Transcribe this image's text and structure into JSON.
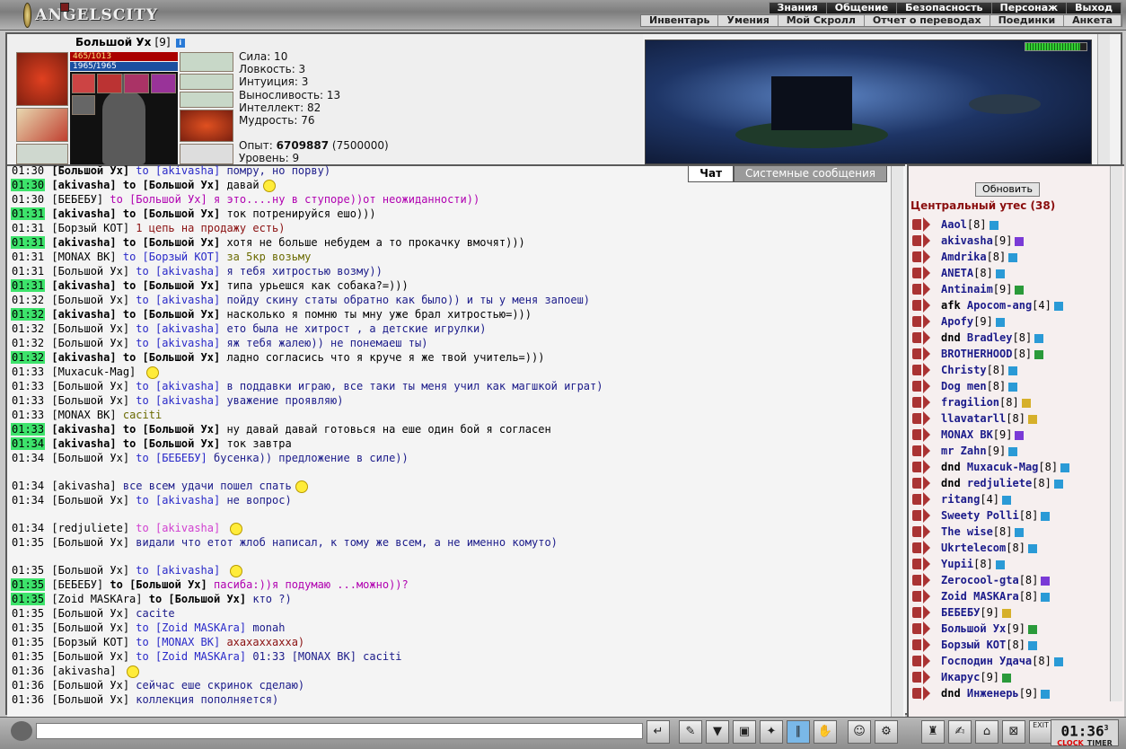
{
  "app": {
    "logo_text": "ANGELSCITY"
  },
  "menu": {
    "top": [
      "Знания",
      "Общение",
      "Безопасность",
      "Персонаж",
      "Выход"
    ],
    "sub": [
      "Инвентарь",
      "Умения",
      "Мой Скролл",
      "Отчет о переводах",
      "Поединки",
      "Анкета"
    ]
  },
  "character": {
    "name": "Большой Ух",
    "level": "[9]",
    "hp": "465/1013",
    "mp": "1965/1965",
    "stats": [
      "Сила: 10",
      "Ловкость: 3",
      "Интуиция: 3",
      "Выносливость: 13",
      "Интеллект: 82",
      "Мудрость: 76"
    ],
    "exp_label": "Опыт:",
    "exp_value": "6709887",
    "exp_next": "(7500000)",
    "level_line": "Уровень: 9"
  },
  "tabs": {
    "chat": "Чат",
    "system": "Системные сообщения"
  },
  "chat": [
    {
      "time": "01:30",
      "hl": false,
      "name": "[Большой Ух]",
      "nb": true,
      "to": "to [akivasha]",
      "tob": false,
      "text": "помру, но порву)",
      "tc": "tx"
    },
    {
      "time": "01:30",
      "hl": true,
      "name": "[akivasha]",
      "nb": true,
      "to": "to [Большой Ух]",
      "tob": true,
      "text": "давай",
      "tc": "txb",
      "smile": true
    },
    {
      "time": "01:30",
      "hl": false,
      "name": "[БЕБЕБУ]",
      "nb": false,
      "to": "to [Большой Ух]",
      "tob": false,
      "priv": true,
      "text": "я это....ну в ступоре))от неожиданности))",
      "tc": "priv"
    },
    {
      "time": "01:31",
      "hl": true,
      "name": "[akivasha]",
      "nb": true,
      "to": "to [Большой Ух]",
      "tob": true,
      "text": "ток потренируйся ешо)))",
      "tc": "txb"
    },
    {
      "time": "01:31",
      "hl": false,
      "name": "[Борзый КОТ]",
      "nb": false,
      "to": "",
      "tob": false,
      "text": "1 цепь на продажу есть)",
      "tc": "txr"
    },
    {
      "time": "01:31",
      "hl": true,
      "name": "[akivasha]",
      "nb": true,
      "to": "to [Большой Ух]",
      "tob": true,
      "text": "хотя не больше небудем а то прокачку вмочят)))",
      "tc": "txb"
    },
    {
      "time": "01:31",
      "hl": false,
      "name": "[MONAX BK]",
      "nb": false,
      "to": "to [Борзый КОТ]",
      "tob": false,
      "text": "за 5кр возьму",
      "tc": "txo"
    },
    {
      "time": "01:31",
      "hl": false,
      "name": "[Большой Ух]",
      "nb": false,
      "to": "to [akivasha]",
      "tob": false,
      "text": "я тебя хитростью возму))",
      "tc": "tx"
    },
    {
      "time": "01:31",
      "hl": true,
      "name": "[akivasha]",
      "nb": true,
      "to": "to [Большой Ух]",
      "tob": true,
      "text": "типа урьешся как собака?=)))",
      "tc": "txb"
    },
    {
      "time": "01:32",
      "hl": false,
      "name": "[Большой Ух]",
      "nb": false,
      "to": "to [akivasha]",
      "tob": false,
      "text": "пойду скину статы обратно как было)) и ты у меня запоеш)",
      "tc": "tx"
    },
    {
      "time": "01:32",
      "hl": true,
      "name": "[akivasha]",
      "nb": true,
      "to": "to [Большой Ух]",
      "tob": true,
      "text": "насколько я помню ты мну уже брал хитростью=)))",
      "tc": "txb"
    },
    {
      "time": "01:32",
      "hl": false,
      "name": "[Большой Ух]",
      "nb": false,
      "to": "to [akivasha]",
      "tob": false,
      "text": "ето была не хитрост , а детские игрулки)",
      "tc": "tx"
    },
    {
      "time": "01:32",
      "hl": false,
      "name": "[Большой Ух]",
      "nb": false,
      "to": "to [akivasha]",
      "tob": false,
      "text": "яж тебя жалею)) не понемаеш ты)",
      "tc": "tx"
    },
    {
      "time": "01:32",
      "hl": true,
      "name": "[akivasha]",
      "nb": true,
      "to": "to [Большой Ух]",
      "tob": true,
      "text": "ладно согласись что я круче я же твой учитель=)))",
      "tc": "txb"
    },
    {
      "time": "01:33",
      "hl": false,
      "name": "[Muxacuk-Mag]",
      "nb": false,
      "to": "",
      "tob": false,
      "text": "",
      "tc": "tx",
      "smile": true
    },
    {
      "time": "01:33",
      "hl": false,
      "name": "[Большой Ух]",
      "nb": false,
      "to": "to [akivasha]",
      "tob": false,
      "text": "в поддавки играю, все таки ты меня учил как магшкой играт)",
      "tc": "tx"
    },
    {
      "time": "01:33",
      "hl": false,
      "name": "[Большой Ух]",
      "nb": false,
      "to": "to [akivasha]",
      "tob": false,
      "text": "уважение проявляю)",
      "tc": "tx"
    },
    {
      "time": "01:33",
      "hl": false,
      "name": "[MONAX BK]",
      "nb": false,
      "to": "",
      "tob": false,
      "text": "caciti",
      "tc": "txo"
    },
    {
      "time": "01:33",
      "hl": true,
      "name": "[akivasha]",
      "nb": true,
      "to": "to [Большой Ух]",
      "tob": true,
      "text": "ну давай давай готовься на еше один бой я согласен",
      "tc": "txb"
    },
    {
      "time": "01:34",
      "hl": true,
      "name": "[akivasha]",
      "nb": true,
      "to": "to [Большой Ух]",
      "tob": true,
      "text": "ток завтра",
      "tc": "txb"
    },
    {
      "time": "01:34",
      "hl": false,
      "name": "[Большой Ух]",
      "nb": false,
      "to": "to [БЕБЕБУ]",
      "tob": false,
      "text": "бусенка)) предложение в силе))",
      "tc": "tx"
    },
    {
      "time": "01:34",
      "hl": false,
      "gap": true,
      "name": "[akivasha]",
      "nb": false,
      "to": "",
      "tob": false,
      "text": "все всем удачи пошел спать",
      "tc": "tx",
      "smile": true
    },
    {
      "time": "01:34",
      "hl": false,
      "name": "[Большой Ух]",
      "nb": false,
      "to": "to [akivasha]",
      "tob": false,
      "text": "не вопрос)",
      "tc": "tx"
    },
    {
      "time": "01:34",
      "hl": false,
      "gap": true,
      "name": "[redjuliete]",
      "nb": false,
      "to": "to [akivasha]",
      "tob": false,
      "priv2": true,
      "text": "",
      "tc": "tx",
      "smile": true
    },
    {
      "time": "01:35",
      "hl": false,
      "name": "[Большой Ух]",
      "nb": false,
      "to": "",
      "tob": false,
      "text": "видали что етот жлоб написал, к тому же всем, а не именно комуто)",
      "tc": "tx"
    },
    {
      "time": "01:35",
      "hl": false,
      "gap": true,
      "name": "[Большой Ух]",
      "nb": false,
      "to": "to [akivasha]",
      "tob": false,
      "text": "",
      "tc": "tx",
      "smile": true
    },
    {
      "time": "01:35",
      "hl": true,
      "name": "[БЕБЕБУ]",
      "nb": false,
      "to": "to [Большой Ух]",
      "tob": true,
      "priv": true,
      "text": "пасиба:))я подумаю ...можно))?",
      "tc": "priv"
    },
    {
      "time": "01:35",
      "hl": true,
      "name": "[Zoid MASKAra]",
      "nb": false,
      "to": "to [Большой Ух]",
      "tob": true,
      "text": "кто ?)",
      "tc": "tx"
    },
    {
      "time": "01:35",
      "hl": false,
      "name": "[Большой Ух]",
      "nb": false,
      "to": "",
      "tob": false,
      "text": "cacite",
      "tc": "tx"
    },
    {
      "time": "01:35",
      "hl": false,
      "name": "[Большой Ух]",
      "nb": false,
      "to": "to [Zoid MASKAra]",
      "tob": false,
      "text": "monah",
      "tc": "tx"
    },
    {
      "time": "01:35",
      "hl": false,
      "name": "[Борзый КОТ]",
      "nb": false,
      "to": "to [MONAX BK]",
      "tob": false,
      "text": "ахахаххахха)",
      "tc": "txr"
    },
    {
      "time": "01:35",
      "hl": false,
      "name": "[Большой Ух]",
      "nb": false,
      "to": "to [Zoid MASKAra]",
      "tob": false,
      "text": "01:33 [MONAX BK] caciti",
      "tc": "tx"
    },
    {
      "time": "01:36",
      "hl": false,
      "name": "[akivasha]",
      "nb": false,
      "to": "",
      "tob": false,
      "text": "",
      "tc": "tx",
      "smile": true
    },
    {
      "time": "01:36",
      "hl": false,
      "name": "[Большой Ух]",
      "nb": false,
      "to": "",
      "tob": false,
      "text": "сейчас еше скринок сделаю)",
      "tc": "tx"
    },
    {
      "time": "01:36",
      "hl": false,
      "name": "[Большой Ух]",
      "nb": false,
      "to": "",
      "tob": false,
      "text": "коллекция пополняется)",
      "tc": "tx"
    }
  ],
  "room": {
    "refresh": "Обновить",
    "title": "Центральный утес (38)"
  },
  "users": [
    {
      "pre": "",
      "name": "Aaol",
      "lvl": "[8]",
      "i": ""
    },
    {
      "pre": "",
      "name": "akivasha",
      "lvl": "[9]",
      "i": "p"
    },
    {
      "pre": "",
      "name": "Amdrika",
      "lvl": "[8]",
      "i": ""
    },
    {
      "pre": "",
      "name": "ANETA",
      "lvl": "[8]",
      "i": ""
    },
    {
      "pre": "",
      "name": "Antinaim",
      "lvl": "[9]",
      "i": "g"
    },
    {
      "pre": "afk",
      "name": "Apocom-ang",
      "lvl": "[4]",
      "i": ""
    },
    {
      "pre": "",
      "name": "Apofy",
      "lvl": "[9]",
      "i": ""
    },
    {
      "pre": "dnd",
      "name": "Bradley",
      "lvl": "[8]",
      "i": ""
    },
    {
      "pre": "",
      "name": "BROTHERHOOD",
      "lvl": "[8]",
      "i": "g"
    },
    {
      "pre": "",
      "name": "Christy",
      "lvl": "[8]",
      "i": ""
    },
    {
      "pre": "",
      "name": "Dog men",
      "lvl": "[8]",
      "i": ""
    },
    {
      "pre": "",
      "name": "fragilion",
      "lvl": "[8]",
      "i": "y"
    },
    {
      "pre": "",
      "name": "llavatarll",
      "lvl": "[8]",
      "i": "y"
    },
    {
      "pre": "",
      "name": "MONAX BK",
      "lvl": "[9]",
      "i": "p"
    },
    {
      "pre": "",
      "name": "mr Zahn",
      "lvl": "[9]",
      "i": ""
    },
    {
      "pre": "dnd",
      "name": "Muxacuk-Mag",
      "lvl": "[8]",
      "i": ""
    },
    {
      "pre": "dnd",
      "name": "redjuliete",
      "lvl": "[8]",
      "i": ""
    },
    {
      "pre": "",
      "name": "ritang",
      "lvl": "[4]",
      "i": ""
    },
    {
      "pre": "",
      "name": "Sweety Polli",
      "lvl": "[8]",
      "i": ""
    },
    {
      "pre": "",
      "name": "The wise",
      "lvl": "[8]",
      "i": ""
    },
    {
      "pre": "",
      "name": "Ukrtelecom",
      "lvl": "[8]",
      "i": ""
    },
    {
      "pre": "",
      "name": "Yupii",
      "lvl": "[8]",
      "i": ""
    },
    {
      "pre": "",
      "name": "Zerocool-gta",
      "lvl": "[8]",
      "i": "p"
    },
    {
      "pre": "",
      "name": "Zoid MASKAra",
      "lvl": "[8]",
      "i": ""
    },
    {
      "pre": "",
      "name": "БЕБЕБУ",
      "lvl": "[9]",
      "i": "y"
    },
    {
      "pre": "",
      "name": "Большой Ух",
      "lvl": "[9]",
      "i": "g"
    },
    {
      "pre": "",
      "name": "Борзый КОТ",
      "lvl": "[8]",
      "i": ""
    },
    {
      "pre": "",
      "name": "Господин Удача",
      "lvl": "[8]",
      "i": ""
    },
    {
      "pre": "",
      "name": "Икарус",
      "lvl": "[9]",
      "i": "g"
    },
    {
      "pre": "dnd",
      "name": "Инженерь",
      "lvl": "[9]",
      "i": ""
    }
  ],
  "bottom": {
    "clock": "01:36",
    "clock_seconds": "3",
    "clock_label": "CLOCK",
    "timer_label": "TIMER",
    "exit_label": "EXIT"
  },
  "colors": {
    "time_highlight": "#3de36b",
    "room_title": "#8a0e0e",
    "private_msg": "#b000b0"
  }
}
